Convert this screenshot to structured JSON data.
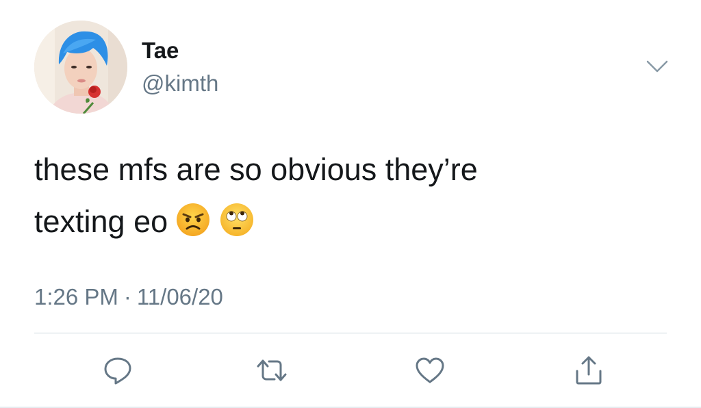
{
  "tweet": {
    "display_name": "Tae",
    "handle": "@kimth",
    "text_line1": "these mfs are so obvious they’re",
    "text_line2": "texting eo",
    "emojis": [
      "angry-face-emoji",
      "face-with-rolling-eyes-emoji"
    ],
    "time": "1:26 PM",
    "separator": "·",
    "date": "11/06/20"
  },
  "actions": [
    {
      "name": "reply",
      "icon": "reply-icon"
    },
    {
      "name": "retweet",
      "icon": "retweet-icon"
    },
    {
      "name": "like",
      "icon": "heart-icon"
    },
    {
      "name": "share",
      "icon": "share-icon"
    }
  ],
  "colors": {
    "text": "#14171a",
    "secondary": "#657786",
    "divider": "#ccd6dd",
    "icon": "#657786"
  }
}
